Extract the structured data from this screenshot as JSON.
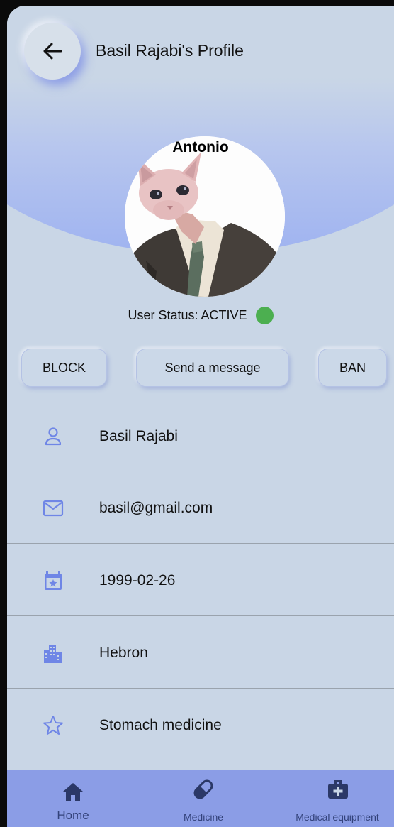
{
  "header": {
    "title": "Basil Rajabi's Profile",
    "back_icon": "arrow-left-icon"
  },
  "profile": {
    "display_name": "Antonio",
    "status_text": "User Status: ACTIVE",
    "status_color": "#4caf50"
  },
  "actions": {
    "block": "BLOCK",
    "message": "Send a message",
    "ban": "BAN"
  },
  "details": [
    {
      "icon": "person-icon",
      "text": "Basil Rajabi"
    },
    {
      "icon": "mail-icon",
      "text": "basil@gmail.com"
    },
    {
      "icon": "calendar-icon",
      "text": "1999-02-26"
    },
    {
      "icon": "city-icon",
      "text": "Hebron"
    },
    {
      "icon": "star-icon",
      "text": "Stomach medicine"
    }
  ],
  "nav": {
    "home": "Home",
    "medicine": "Medicine",
    "equipment": "Medical equipment"
  },
  "colors": {
    "accent": "#6f86e6",
    "nav_bg": "#8b9de6",
    "background": "#c9d6e6"
  }
}
